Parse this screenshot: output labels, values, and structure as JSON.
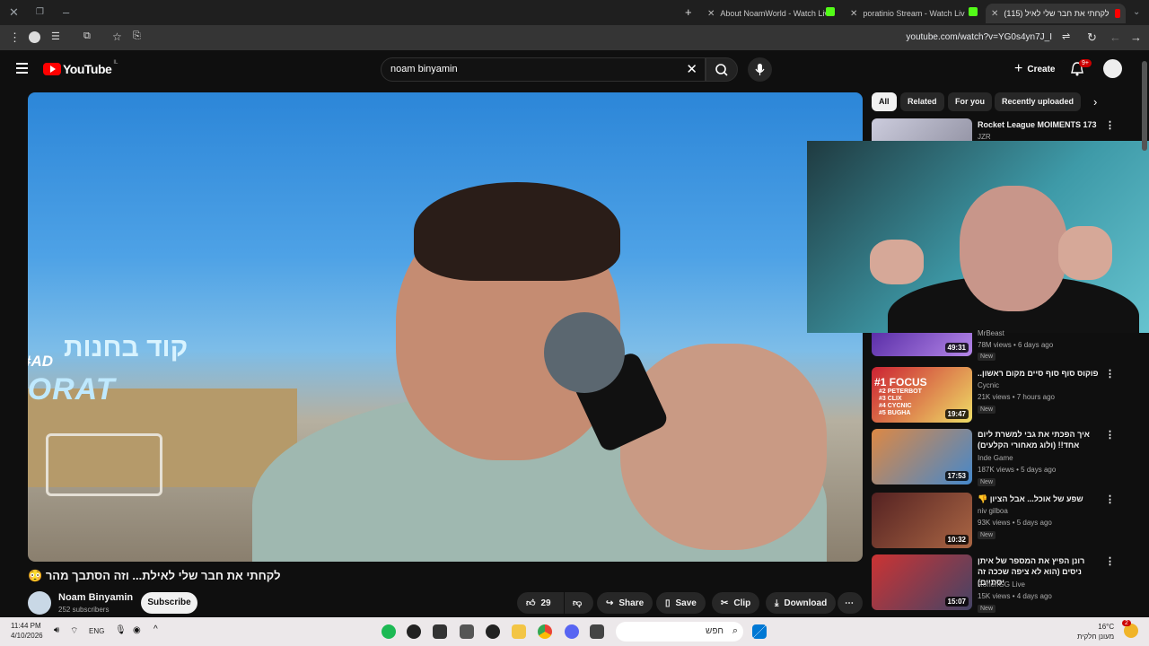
{
  "browser": {
    "tabs": [
      {
        "title": "About NoamWorld - Watch Liv",
        "active": false
      },
      {
        "title": "poratinio Stream - Watch Live",
        "active": false
      },
      {
        "title": "(115) לקחתי את חבר שלי לאיל",
        "active": true
      }
    ],
    "new_tab": "+",
    "url": "youtube.com/watch?v=YG0s4yn7J_I"
  },
  "youtube": {
    "logo_text": "YouTube",
    "country_code": "IL",
    "search_query": "noam binyamin",
    "create_label": "Create",
    "notifications_badge": "9+"
  },
  "video": {
    "overlay_ad": "#AD",
    "overlay_name": "PORAT",
    "overlay_hebrew": "קוד בחנות",
    "title": "לקחתי את חבר שלי לאילת... וזה הסתבך מהר",
    "title_emoji": "😳",
    "channel": "Noam Binyamin",
    "subscribers": "252 subscribers",
    "subscribe_label": "Subscribe",
    "likes": "29",
    "share_label": "Share",
    "save_label": "Save",
    "clip_label": "Clip",
    "download_label": "Download"
  },
  "chips": [
    "All",
    "Related",
    "For you",
    "Recently uploaded"
  ],
  "recommendations": [
    {
      "title": "Rocket League MOIMENTS 173",
      "channel": "JZR",
      "views": "",
      "age": "",
      "duration": "",
      "new": false
    },
    {
      "title": "",
      "channel": "MrBeast",
      "views": "78M views",
      "age": "6 days ago",
      "duration": "49:31",
      "new": true
    },
    {
      "title": "פוקוס סוף סוף סיים מקום ראשון..",
      "channel": "Cycnic",
      "views": "21K views",
      "age": "7 hours ago",
      "duration": "19:47",
      "new": true
    },
    {
      "title": "איך הפכתי את גבי למשרת ליום אחד!! (ולוג מאחורי הקלעים)",
      "channel": "Inde Game",
      "views": "187K views",
      "age": "5 days ago",
      "duration": "17:53",
      "new": true
    },
    {
      "title": "שפע של אוכל... אבל הציון 👎",
      "channel": "niv gilboa",
      "views": "93K views",
      "age": "5 days ago",
      "duration": "10:32",
      "new": true
    },
    {
      "title": "רונן הפיץ את המספר של איתן ניסים (הוא לא ציפה שככה זה יסתיים)",
      "channel": "RonenGG Live",
      "views": "15K views",
      "age": "4 days ago",
      "duration": "15:07",
      "new": true
    }
  ],
  "new_label": "New",
  "thumb_texts": {
    "focus": "#1 FOCUS",
    "focus_list": [
      "#2 PETERBOT",
      "#3 CLIX",
      "#4 CYCNIC",
      "#5 BUGHA"
    ]
  },
  "taskbar": {
    "time": "11:44 PM",
    "date": "4/10/2026",
    "lang": "ENG",
    "search_placeholder": "חפש",
    "temp": "16°C",
    "weather": "מעונן חלקית",
    "weather_badge": "2"
  }
}
